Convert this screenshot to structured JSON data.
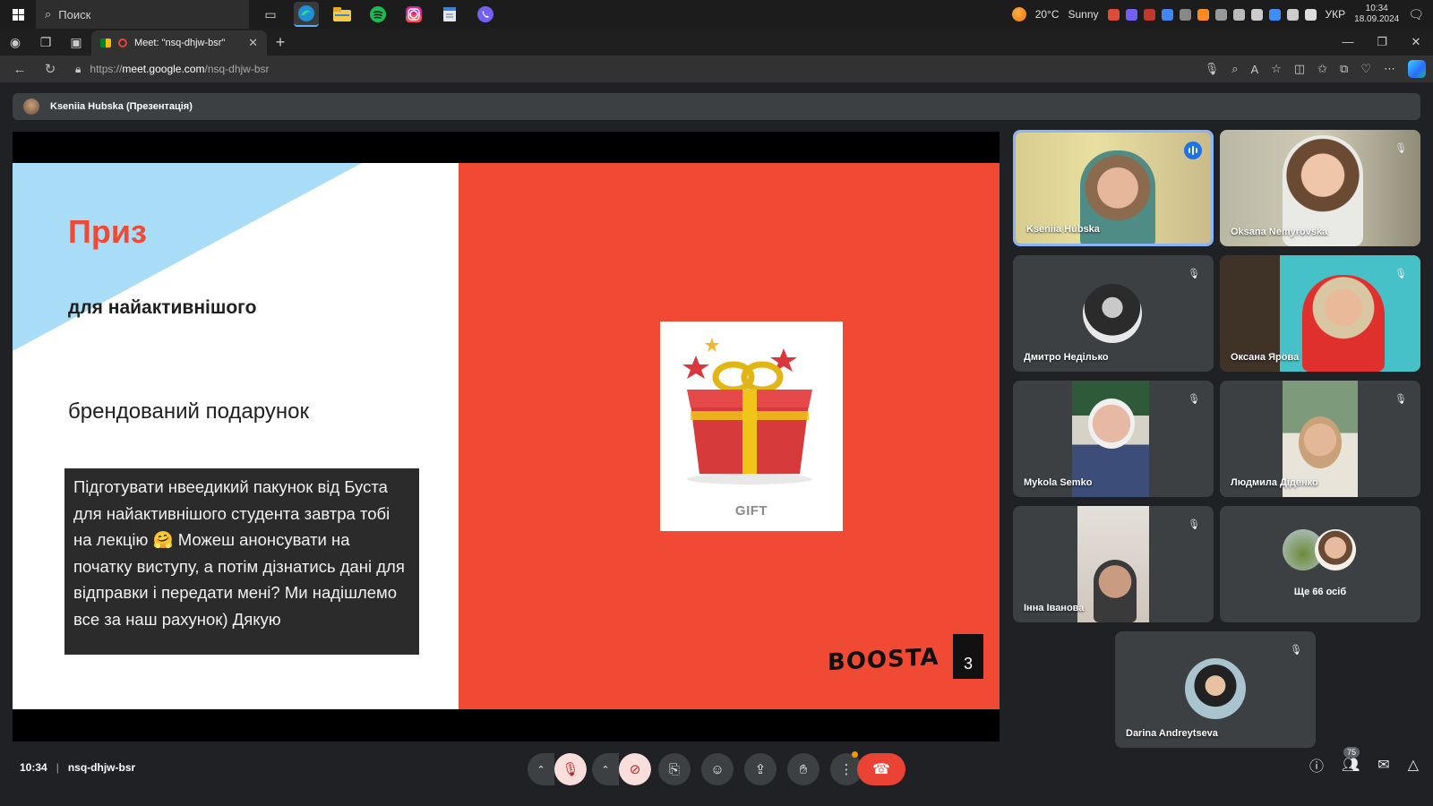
{
  "taskbar": {
    "search_placeholder": "Поиск",
    "weather_temp": "20°C",
    "weather_cond": "Sunny",
    "lang": "УКР",
    "time": "10:34",
    "date": "18.09.2024",
    "apps": [
      "task-view-icon",
      "edge-icon",
      "file-explorer-icon",
      "spotify-icon",
      "instagram-icon",
      "notepad-icon",
      "viber-icon"
    ]
  },
  "browser": {
    "tab_title": "Meet: \"nsq-dhjw-bsr\"",
    "url_prefix": "https://",
    "url_host": "meet.google.com",
    "url_path": "/nsq-dhjw-bsr"
  },
  "meet": {
    "presenter_label": "Kseniia Hubska (Презентація)",
    "slide": {
      "title": "Приз",
      "subtitle": "для найактивнішого",
      "gift_text": "брендований подарунок",
      "note": "Підготувати нвеедикий пакунок від Буста для найактивнішого студента завтра тобі на лекцію 🤗 Можеш анонсувати на початку виступу, а потім дізнатись дані для відправки і передати мені? Ми надішлемо все за наш рахунок) Дякую",
      "gift_label": "GIFT",
      "logo": "BOOSTA",
      "page": "3"
    },
    "participants": [
      {
        "name": "Kseniia Hubska",
        "speaking": true
      },
      {
        "name": "Oksana Nemyrovska"
      },
      {
        "name": "Дмитро Неділько"
      },
      {
        "name": "Оксана Ярова"
      },
      {
        "name": "Mykola Semko"
      },
      {
        "name": "Людмила Діденко"
      },
      {
        "name": "Інна Іванова"
      },
      {
        "name": "Ще 66 осіб"
      },
      {
        "name": "Darina Andreytseva"
      }
    ],
    "footer": {
      "time": "10:34",
      "separator": "|",
      "meeting_code": "nsq-dhjw-bsr",
      "people_count": "75"
    }
  },
  "colors": {
    "slide_red": "#f04a35",
    "slide_blue": "#a9dcf7",
    "hangup_red": "#ea4335",
    "speaking_blue": "#8ab4f8"
  }
}
